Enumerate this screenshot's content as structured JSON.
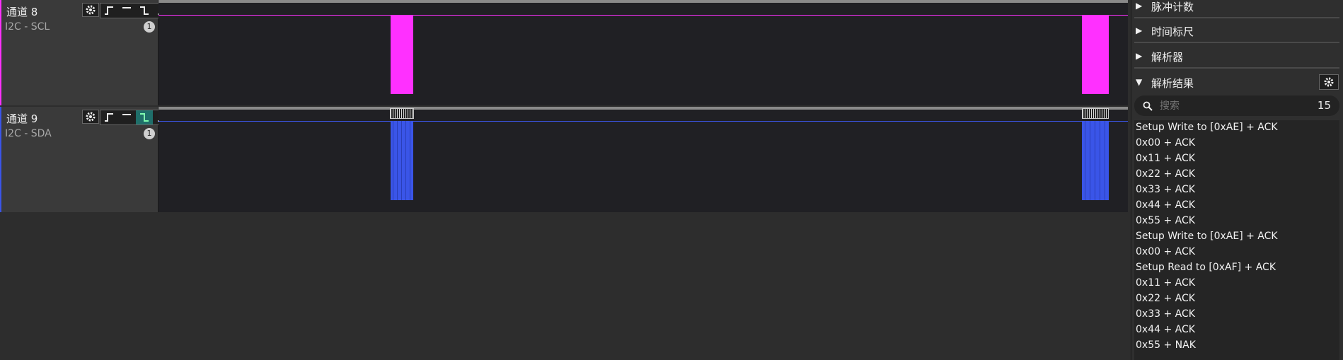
{
  "channels": [
    {
      "name": "通道 8",
      "protocol": "I2C - SCL",
      "badge": "1",
      "color": "#ff30ff"
    },
    {
      "name": "通道 9",
      "protocol": "I2C - SDA",
      "badge": "1",
      "color": "#3a55e8"
    }
  ],
  "panel": {
    "sections": [
      {
        "label": "脉冲计数",
        "expanded": false
      },
      {
        "label": "时间标尺",
        "expanded": false
      },
      {
        "label": "解析器",
        "expanded": false
      },
      {
        "label": "解析结果",
        "expanded": true
      }
    ],
    "search": {
      "placeholder": "搜索",
      "count": "15"
    },
    "results": [
      "Setup Write to [0xAE] + ACK",
      "0x00 + ACK",
      "0x11 + ACK",
      "0x22 + ACK",
      "0x33 + ACK",
      "0x44 + ACK",
      "0x55 + ACK",
      "Setup Write to [0xAE] + ACK",
      "0x00 + ACK",
      "Setup Read to [0xAF] + ACK",
      "0x11 + ACK",
      "0x22 + ACK",
      "0x33 + ACK",
      "0x44 + ACK",
      "0x55 + NAK"
    ]
  },
  "icons": {
    "settings": "gear-icon",
    "trigger_rising": "rising-edge-icon",
    "trigger_high": "high-level-icon",
    "trigger_falling": "falling-edge-icon",
    "trigger_low": "low-level-icon",
    "search": "search-icon"
  }
}
